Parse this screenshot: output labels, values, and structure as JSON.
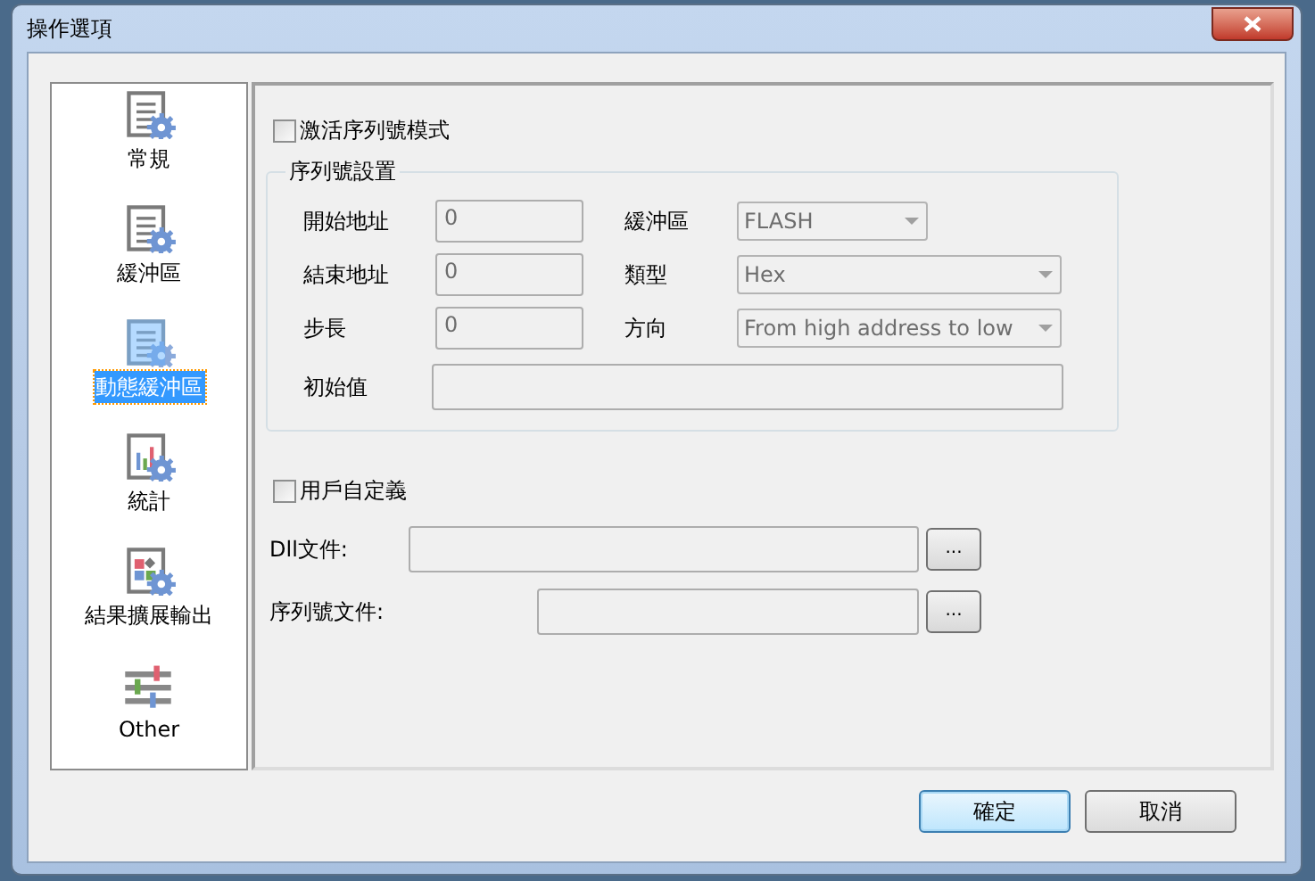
{
  "window": {
    "title": "操作選項"
  },
  "sidebar": {
    "items": [
      {
        "label": "常規",
        "kind": "document",
        "selected": false
      },
      {
        "label": "緩沖區",
        "kind": "document",
        "selected": false
      },
      {
        "label": "動態緩沖區",
        "kind": "document",
        "selected": true
      },
      {
        "label": "統計",
        "kind": "chart",
        "selected": false
      },
      {
        "label": "結果擴展輸出",
        "kind": "blocks",
        "selected": false
      },
      {
        "label": "Other",
        "kind": "sliders",
        "selected": false
      }
    ]
  },
  "activate": {
    "label": "激活序列號模式",
    "checked": false
  },
  "serial_settings": {
    "title": "序列號設置",
    "left_fields": [
      {
        "label": "開始地址",
        "value": "0",
        "disabled": true
      },
      {
        "label": "結束地址",
        "value": "0",
        "disabled": true
      },
      {
        "label": "步長",
        "value": "0",
        "disabled": true
      }
    ],
    "right_fields": [
      {
        "label": "緩沖區",
        "value": "FLASH",
        "disabled": true,
        "kind": "short"
      },
      {
        "label": "類型",
        "value": "Hex",
        "disabled": true,
        "kind": "long"
      },
      {
        "label": "方向",
        "value": "From high address to low",
        "disabled": true,
        "kind": "long"
      }
    ],
    "initial_value": {
      "label": "初始值",
      "disabled": true
    }
  },
  "user_defined": {
    "label": "用戶自定義",
    "checked": false
  },
  "files": [
    {
      "label": "Dll文件:",
      "button": "...",
      "disabled": true,
      "kind": "wide"
    },
    {
      "label": "序列號文件:",
      "button": "...",
      "disabled": true,
      "kind": "narrow"
    }
  ],
  "buttons": [
    {
      "label": "確定",
      "default": true
    },
    {
      "label": "取消",
      "default": false
    }
  ]
}
